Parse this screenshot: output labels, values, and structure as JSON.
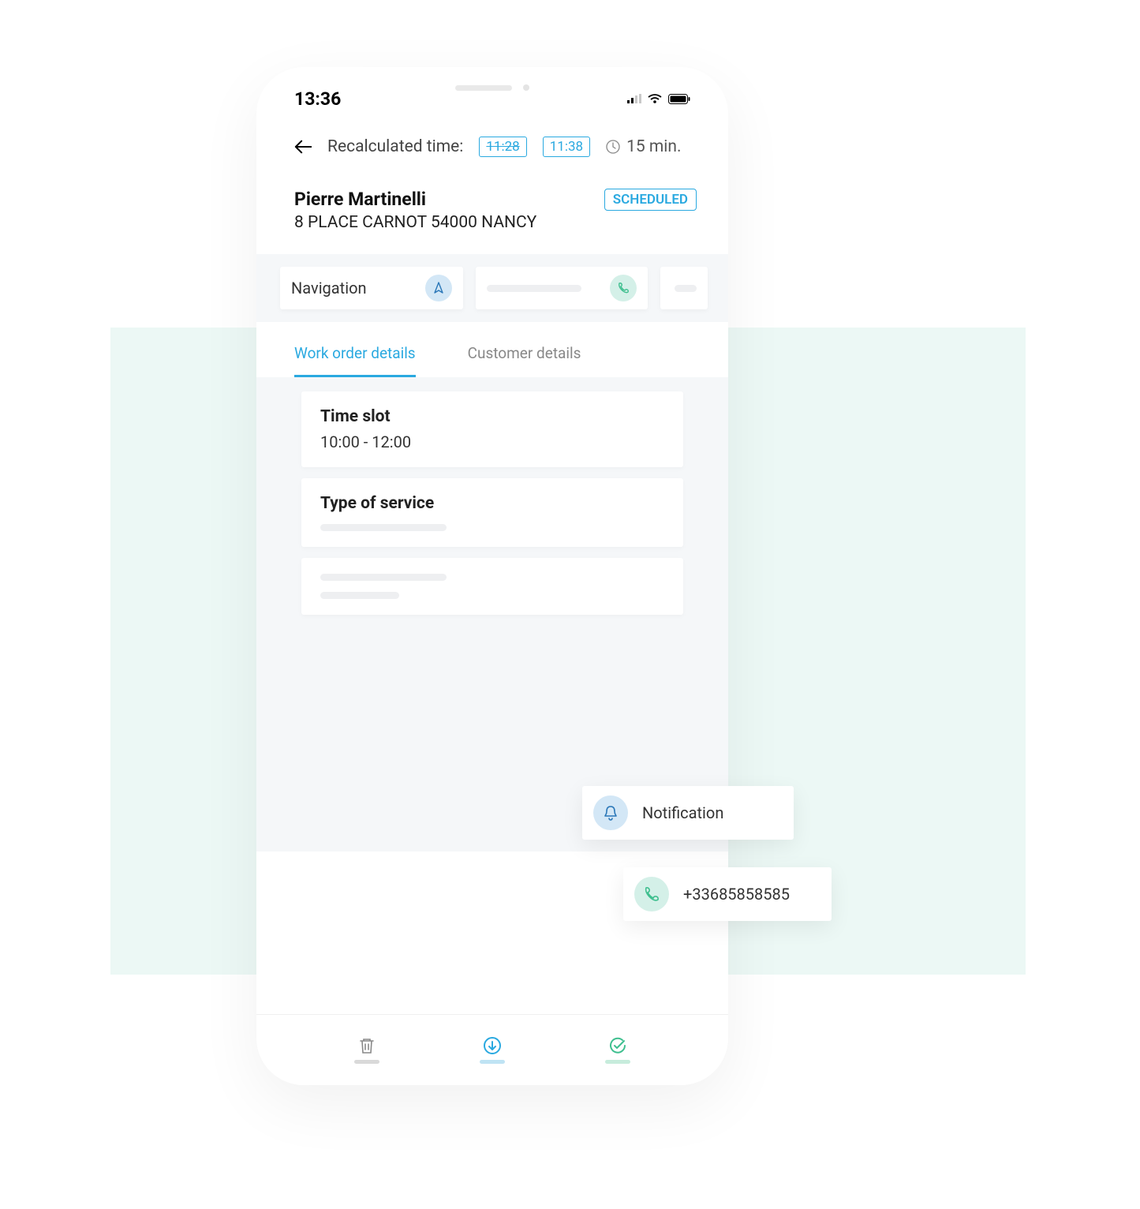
{
  "statusbar": {
    "time": "13:36"
  },
  "header": {
    "recalculated_label": "Recalculated time:",
    "old_time": "11:28",
    "new_time": "11:38",
    "duration": "15 min."
  },
  "customer": {
    "name": "Pierre Martinelli",
    "address": "8 PLACE CARNOT 54000 NANCY",
    "status": "SCHEDULED"
  },
  "actions": {
    "navigation_label": "Navigation"
  },
  "tabs": {
    "work_order": "Work order details",
    "customer": "Customer details"
  },
  "cards": {
    "timeslot_title": "Time slot",
    "timeslot_value": "10:00 - 12:00",
    "service_title": "Type of service"
  },
  "popovers": {
    "notification": "Notification",
    "phone": "+33685858585"
  },
  "colors": {
    "accent_blue": "#2aa9e0",
    "accent_green": "#3fbf8f",
    "bg_light_teal": "#ecf8f5"
  }
}
